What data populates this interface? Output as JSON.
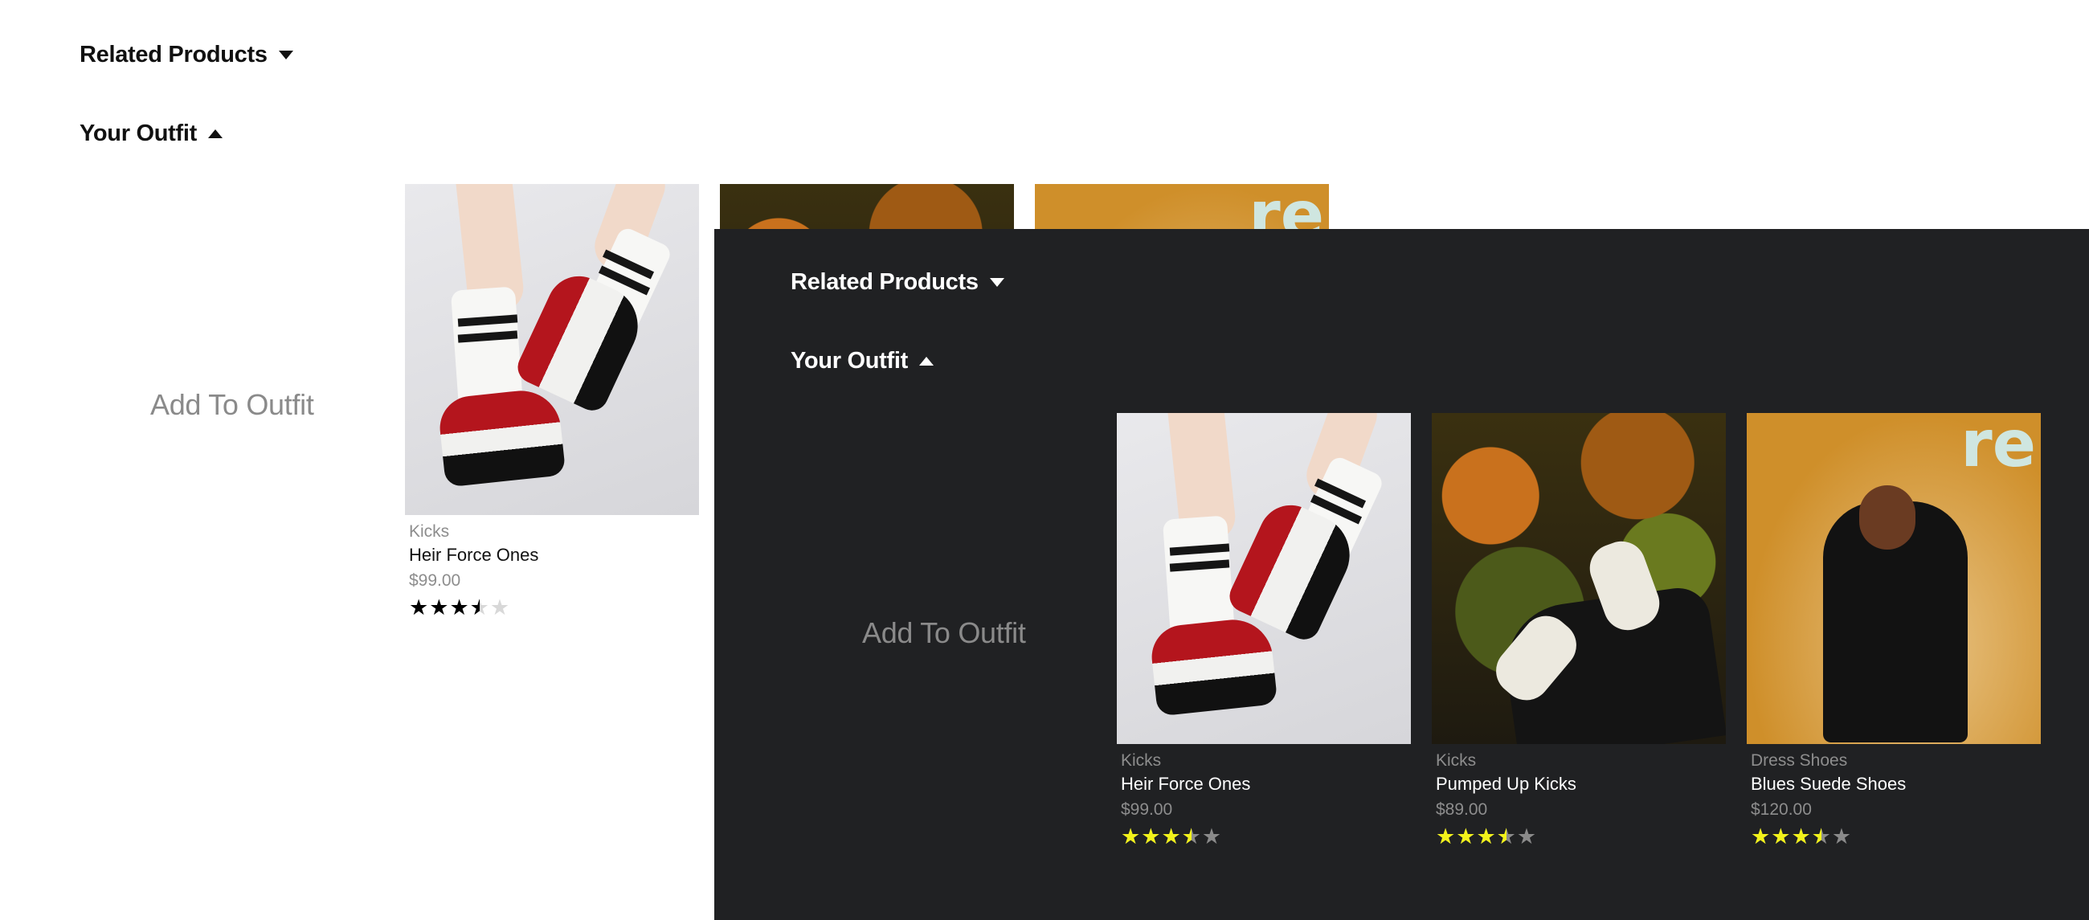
{
  "light": {
    "related_products_label": "Related Products",
    "your_outfit_label": "Your Outfit",
    "add_to_outfit_label": "Add To Outfit",
    "cards": [
      {
        "category": "Kicks",
        "name": "Heir Force Ones",
        "price": "$99.00",
        "rating": 3.5
      }
    ],
    "colors": {
      "star_filled": "#000000",
      "star_empty": "#d8d8d8",
      "background": "#ffffff"
    }
  },
  "dark": {
    "related_products_label": "Related Products",
    "your_outfit_label": "Your Outfit",
    "add_to_outfit_label": "Add To Outfit",
    "cards": [
      {
        "category": "Kicks",
        "name": "Heir Force Ones",
        "price": "$99.00",
        "rating": 3.5
      },
      {
        "category": "Kicks",
        "name": "Pumped Up Kicks",
        "price": "$89.00",
        "rating": 3.5
      },
      {
        "category": "Dress Shoes",
        "name": "Blues Suede Shoes",
        "price": "$120.00",
        "rating": 3.5
      }
    ],
    "colors": {
      "star_filled": "#f2f21a",
      "star_empty": "#8a8a8a",
      "background": "#202123"
    }
  },
  "icons": {
    "related_caret": "caret-down-icon",
    "outfit_caret": "caret-up-icon",
    "star": "star-icon"
  }
}
